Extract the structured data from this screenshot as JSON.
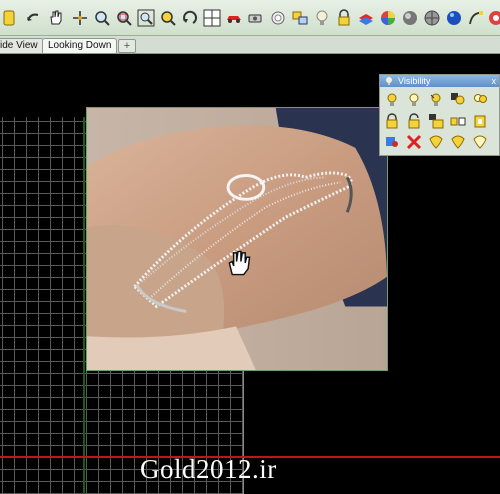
{
  "toolbar": {
    "icons": [
      "select-arrow-icon",
      "undo-icon",
      "pan-hand-icon",
      "move-icon",
      "zoom-icon",
      "zoom-window-icon",
      "rotate-icon",
      "zoom-extents-icon",
      "four-viewports-icon",
      "car-icon",
      "camera-icon",
      "record-icon",
      "boundary-icon",
      "lightbulb-icon",
      "lock-icon",
      "layer-icon",
      "color-wheel-icon",
      "shade-sphere-icon",
      "rendered-sphere-icon",
      "render-sphere-icon",
      "curve-icon",
      "more-icon"
    ]
  },
  "tabs": {
    "side_view": "ide View",
    "looking_down": "Looking Down",
    "add": "+"
  },
  "visibility_panel": {
    "title": "Visibility",
    "close": "x",
    "icons": [
      "show-icon",
      "show-selected-icon",
      "hide-icon",
      "swap-visibility-icon",
      "show-all-icon",
      "lock-icon",
      "unlock-icon",
      "lock-selected-icon",
      "swap-lock-icon",
      "lock-all-icon",
      "isolate-icon",
      "hide-red-icon",
      "show-bulb-icon",
      "hide-bulb-icon",
      "more-icon"
    ]
  },
  "watermark": "Gold2012.ir",
  "colors": {
    "toolbar_bg": "#d8e6d4",
    "viewport_bg": "#000000",
    "grid_line": "#5a5a5a",
    "x_axis": "#c21515",
    "panel_title": "#6f9bd2"
  }
}
